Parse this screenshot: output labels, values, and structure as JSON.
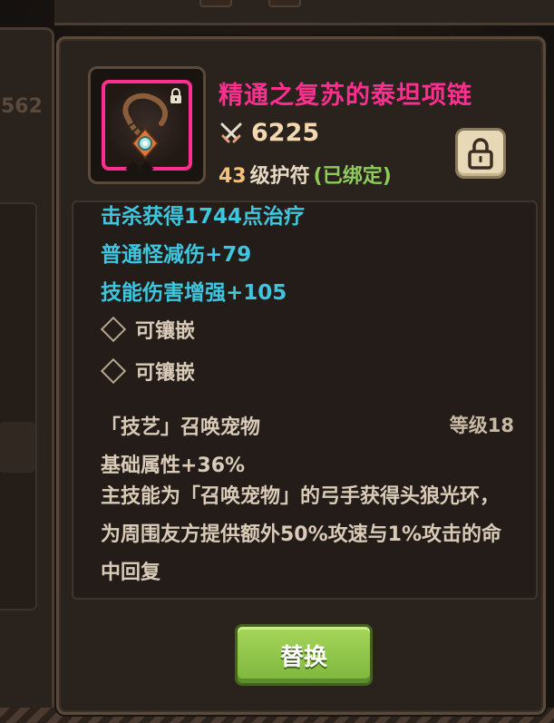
{
  "background": {
    "left_panel_number": "562"
  },
  "item": {
    "name": "精通之复苏的泰坦项链",
    "power": "6225",
    "level": "43",
    "type": "级护符",
    "bound": "(已绑定)",
    "icon": "necklace-icon",
    "rarity_color": "#ff2f8f"
  },
  "lock_button": {
    "icon": "lock-icon"
  },
  "stats": [
    "击杀获得1744点治疗",
    "普通怪减伤+79",
    "技能伤害增强+105"
  ],
  "sockets": [
    "可镶嵌",
    "可镶嵌"
  ],
  "skill": {
    "name": "「技艺」召唤宠物",
    "level": "等级18",
    "base": "基础属性+36%",
    "description": "主技能为「召唤宠物」的弓手获得头狼光环，为周围友方提供额外50%攻速与1%攻击的命中回复"
  },
  "replace_button": {
    "label": "替换"
  }
}
